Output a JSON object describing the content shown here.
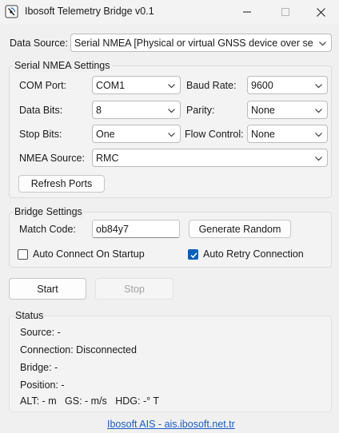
{
  "window": {
    "title": "Ibosoft Telemetry Bridge v0.1",
    "icon": "app-icon",
    "controls": [
      "minimize-icon",
      "maximize-icon",
      "close-icon"
    ]
  },
  "data_source": {
    "label": "Data Source:",
    "value": "Serial NMEA [Physical or virtual GNSS device over serial port]"
  },
  "serial_settings": {
    "group_title": "Serial NMEA Settings",
    "com_port": {
      "label": "COM Port:",
      "value": "COM1"
    },
    "baud_rate": {
      "label": "Baud Rate:",
      "value": "9600"
    },
    "data_bits": {
      "label": "Data Bits:",
      "value": "8"
    },
    "parity": {
      "label": "Parity:",
      "value": "None"
    },
    "stop_bits": {
      "label": "Stop Bits:",
      "value": "One"
    },
    "flow_control": {
      "label": "Flow Control:",
      "value": "None"
    },
    "nmea_source": {
      "label": "NMEA Source:",
      "value": "RMC"
    },
    "refresh_button": "Refresh Ports"
  },
  "bridge_settings": {
    "group_title": "Bridge Settings",
    "match_code": {
      "label": "Match Code:",
      "value": "ob84y7"
    },
    "generate_button": "Generate Random",
    "auto_connect": {
      "label": "Auto Connect On Startup",
      "checked": false
    },
    "auto_retry": {
      "label": "Auto Retry Connection",
      "checked": true
    }
  },
  "actions": {
    "start": "Start",
    "stop": "Stop"
  },
  "status": {
    "title": "Status",
    "source": "Source: -",
    "connection": "Connection: Disconnected",
    "bridge": "Bridge: -",
    "position": "Position: -",
    "metrics": "ALT: - m   GS: - m/s   HDG: -° T"
  },
  "footer": {
    "link": "Ibosoft AIS - ais.ibosoft.net.tr"
  },
  "colors": {
    "accent": "#005fb8",
    "link": "#1a5bc4",
    "window_bg": "#f0f0f0"
  }
}
